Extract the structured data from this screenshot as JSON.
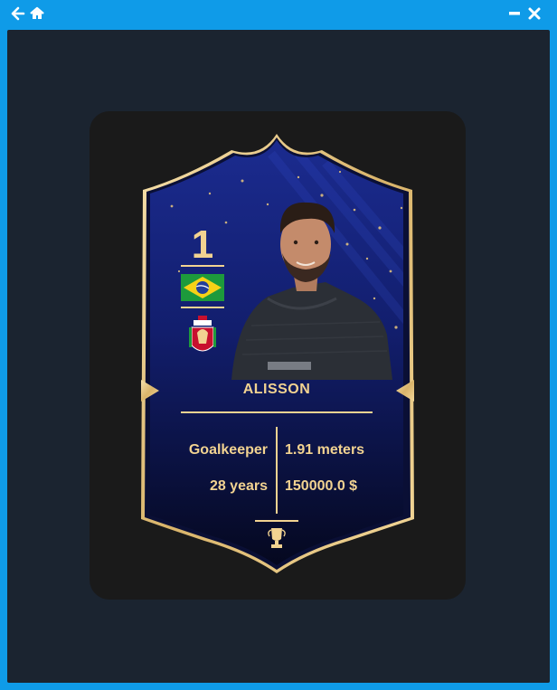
{
  "window": {
    "back_icon": "arrow-left-icon",
    "home_icon": "home-icon",
    "minimize_icon": "minimize-icon",
    "close_icon": "close-icon"
  },
  "card": {
    "rating": "1",
    "name": "ALISSON",
    "position": "Goalkeeper",
    "height": "1.91 meters",
    "age": "28 years",
    "value": "150000.0 $",
    "nation_flag": "brazil-flag",
    "club_crest": "liverpool-crest",
    "trophy_icon": "trophy-icon",
    "player_photo": "player-photo",
    "colors": {
      "gold": "#f2d391",
      "card_top": "#1a2a8a",
      "card_bottom": "#06092a"
    }
  }
}
